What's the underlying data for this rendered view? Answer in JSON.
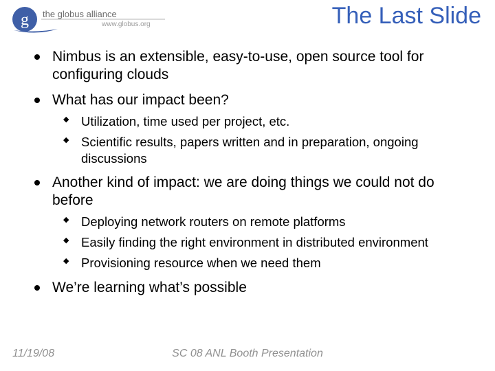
{
  "logo": {
    "initial": "g",
    "text_top": "the globus alliance",
    "text_bottom": "www.globus.org"
  },
  "title": "The Last Slide",
  "bullets": [
    {
      "text": "Nimbus is an extensible, easy-to-use, open source tool for configuring clouds",
      "sub": []
    },
    {
      "text": "What has our impact been?",
      "sub": [
        "Utilization, time used per project, etc.",
        "Scientific results, papers written and in preparation, ongoing discussions"
      ]
    },
    {
      "text": "Another kind of impact: we are doing things we could not do before",
      "sub": [
        "Deploying network routers on remote platforms",
        "Easily finding the right environment in distributed environment",
        "Provisioning resource when we need them"
      ]
    },
    {
      "text": "We’re learning what’s possible",
      "sub": []
    }
  ],
  "footer": {
    "date": "11/19/08",
    "center": "SC 08 ANL Booth Presentation"
  },
  "colors": {
    "title": "#355fb9",
    "logo_blue": "#3f5fa7",
    "logo_text": "#6b6b6b",
    "footer": "#909090"
  }
}
